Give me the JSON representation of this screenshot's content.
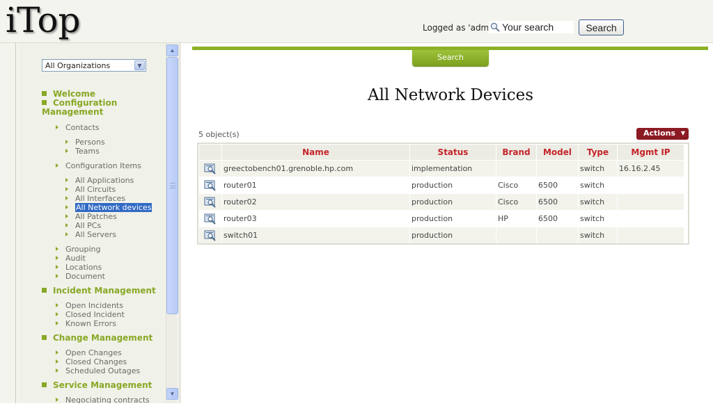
{
  "header": {
    "logo": "iTop",
    "logged_as": "Logged as 'admin'",
    "search_placeholder": "Your search",
    "search_button": "Search"
  },
  "sidebar": {
    "org_selector": "All Organizations",
    "welcome": "Welcome",
    "config_mgmt_line1": "Configuration",
    "config_mgmt_line2": "Management",
    "contacts": "Contacts",
    "persons": "Persons",
    "teams": "Teams",
    "config_items": "Configuration Items",
    "all_applications": "All Applications",
    "all_circuits": "All Circuits",
    "all_interfaces": "All Interfaces",
    "all_network_devices": "All Network devices",
    "all_patches": "All Patches",
    "all_pcs": "All PCs",
    "all_servers": "All Servers",
    "grouping": "Grouping",
    "audit": "Audit",
    "locations": "Locations",
    "document": "Document",
    "incident_mgmt": "Incident Management",
    "open_incidents": "Open Incidents",
    "closed_incident": "Closed Incident",
    "known_errors": "Known Errors",
    "change_mgmt": "Change Management",
    "open_changes": "Open Changes",
    "closed_changes": "Closed Changes",
    "scheduled_outages": "Scheduled Outages",
    "service_mgmt": "Service Management",
    "negotiating_contracts": "Negociating contracts"
  },
  "main": {
    "search_tab": "Search",
    "title": "All Network Devices",
    "object_count": "5 object(s)",
    "actions_button": "Actions",
    "columns": [
      "Name",
      "Status",
      "Brand",
      "Model",
      "Type",
      "Mgmt IP"
    ],
    "rows": [
      {
        "name": "greectobench01.grenoble.hp.com",
        "status": "implementation",
        "brand": "",
        "model": "",
        "type": "switch",
        "mgmt_ip": "16.16.2.45"
      },
      {
        "name": "router01",
        "status": "production",
        "brand": "Cisco",
        "model": "6500",
        "type": "switch",
        "mgmt_ip": ""
      },
      {
        "name": "router02",
        "status": "production",
        "brand": "Cisco",
        "model": "6500",
        "type": "switch",
        "mgmt_ip": ""
      },
      {
        "name": "router03",
        "status": "production",
        "brand": "HP",
        "model": "6500",
        "type": "switch",
        "mgmt_ip": ""
      },
      {
        "name": "switch01",
        "status": "production",
        "brand": "",
        "model": "",
        "type": "switch",
        "mgmt_ip": ""
      }
    ]
  },
  "colors": {
    "accent_green": "#88a826",
    "header_red": "#c4242a",
    "actions_red": "#8b1a22",
    "selection_blue": "#316ac5"
  },
  "icons": {
    "search": "magnifier-icon",
    "row_details": "details-icon",
    "menu_bullet": "square-bullet-icon",
    "submenu_bullet": "triangle-right-icon"
  }
}
